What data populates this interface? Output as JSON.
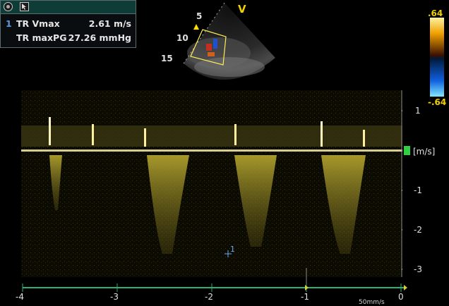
{
  "measurements": {
    "rows": [
      {
        "index": "1",
        "label": "TR Vmax",
        "value": "2.61 m/s"
      },
      {
        "index": "",
        "label": "TR maxPG",
        "value": "27.26 mmHg"
      }
    ]
  },
  "sector": {
    "depth_labels": [
      "5",
      "10",
      "15"
    ],
    "marker": "V"
  },
  "color_scale": {
    "top": ".64",
    "bottom": "-.64"
  },
  "doppler": {
    "unit": "[m/s]",
    "y_ticks": [
      "1",
      "-1",
      "-2",
      "-3"
    ],
    "x_ticks": [
      "-4",
      "-3",
      "-2",
      "-1",
      "0"
    ],
    "cursor_label": "1",
    "sweep_speed": "50mm/s"
  },
  "colors": {
    "accent": "#d8c830",
    "panel_header": "#0e3c36",
    "baseline": "#30b070",
    "index_blue": "#5a9be0"
  }
}
